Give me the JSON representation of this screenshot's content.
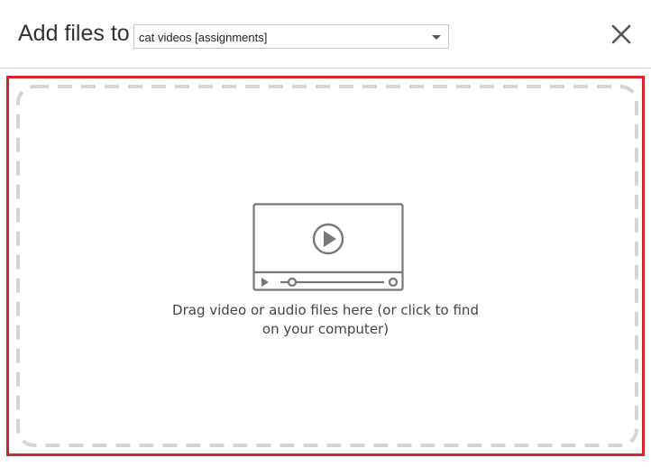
{
  "header": {
    "title": "Add files to",
    "target_select": {
      "selected": "cat videos [assignments]"
    },
    "close_icon": "close-icon"
  },
  "dropzone": {
    "icon": "video-player-icon",
    "instruction_line1": "Drag video or audio files here (or click to find",
    "instruction_line2": "on your computer)",
    "highlight_color": "#d9232e",
    "dash_color": "#d4d4d4"
  }
}
